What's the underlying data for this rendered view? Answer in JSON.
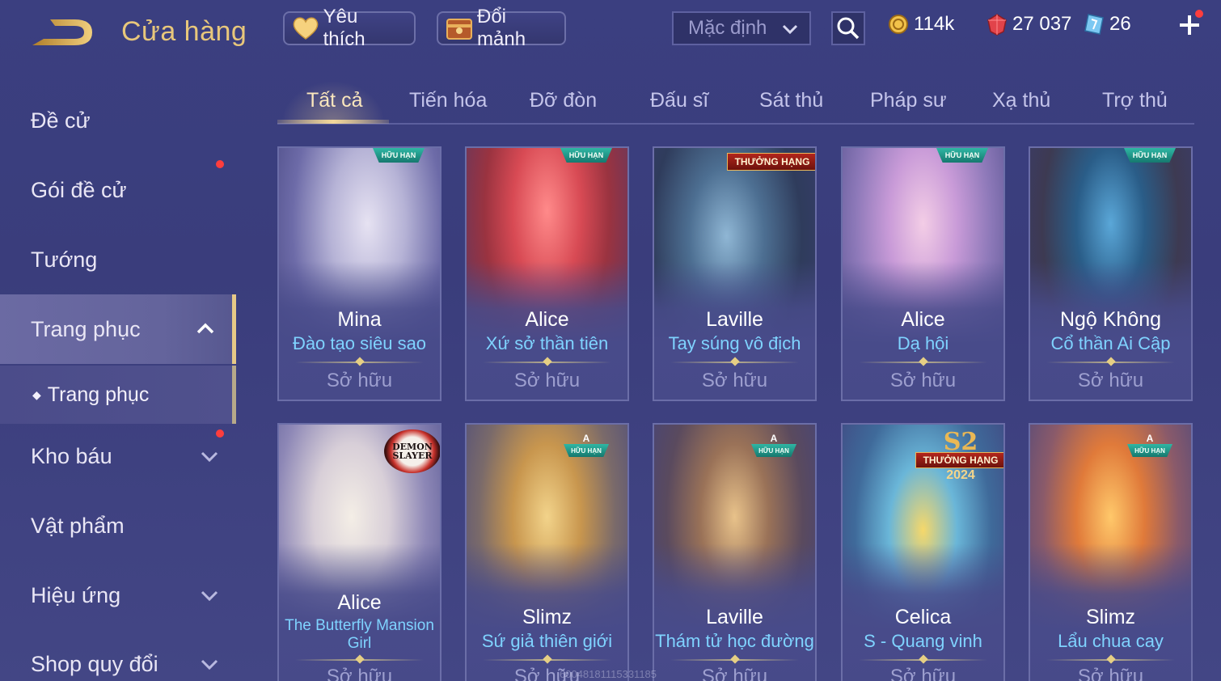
{
  "header": {
    "title": "Cửa hàng",
    "favorite_label": "Yêu thích",
    "exchange_label": "Đổi mảnh",
    "sort_value": "Mặc định"
  },
  "currency": {
    "gold": "114k",
    "ruby": "27 037",
    "voucher": "26"
  },
  "sidebar": {
    "items": [
      {
        "label": "Đề cử"
      },
      {
        "label": "Gói đề cử"
      },
      {
        "label": "Tướng"
      },
      {
        "label": "Trang phục"
      },
      {
        "label": "Trang phục"
      },
      {
        "label": "Kho báu"
      },
      {
        "label": "Vật phẩm"
      },
      {
        "label": "Hiệu ứng"
      },
      {
        "label": "Shop quy đổi"
      }
    ]
  },
  "tabs": [
    "Tất cả",
    "Tiến hóa",
    "Đỡ đòn",
    "Đấu sĩ",
    "Sát thủ",
    "Pháp sư",
    "Xạ thủ",
    "Trợ thủ"
  ],
  "cards": [
    {
      "hero": "Mina",
      "skin": "Đào tạo siêu sao",
      "status": "Sở hữu",
      "badge": "HỮU HẠN"
    },
    {
      "hero": "Alice",
      "skin": "Xứ sở thần tiên",
      "status": "Sở hữu",
      "badge": "HỮU HẠN"
    },
    {
      "hero": "Laville",
      "skin": "Tay súng vô địch",
      "status": "Sở hữu",
      "badge": "THƯỞNG HẠNG"
    },
    {
      "hero": "Alice",
      "skin": "Dạ hội",
      "status": "Sở hữu",
      "badge": "HỮU HẠN"
    },
    {
      "hero": "Ngộ Không",
      "skin": "Cổ thần Ai Cập",
      "status": "Sở hữu",
      "badge": "HỮU HẠN"
    },
    {
      "hero": "Alice",
      "skin": "The Butterfly Mansion Girl",
      "status": "Sở hữu",
      "badge": "DEMON SLAYER"
    },
    {
      "hero": "Slimz",
      "skin": "Sứ giả thiên giới",
      "status": "Sở hữu",
      "badge": "HỮU HẠN",
      "grade": "A"
    },
    {
      "hero": "Laville",
      "skin": "Thám tử học đường",
      "status": "Sở hữu",
      "badge": "HỮU HẠN",
      "grade": "A"
    },
    {
      "hero": "Celica",
      "skin": "S - Quang vinh",
      "status": "Sở hữu",
      "badge": "THƯỞNG HẠNG",
      "season": "S2",
      "year": "2024"
    },
    {
      "hero": "Slimz",
      "skin": "Lẩu chua cay",
      "status": "Sở hữu",
      "badge": "HỮU HẠN",
      "grade": "A"
    }
  ],
  "watermark": "60048181115331185",
  "colors": {
    "accent_gold": "#e8c77b",
    "skin_name": "#7fd3ff",
    "badge_red": "#ff3d3d"
  }
}
